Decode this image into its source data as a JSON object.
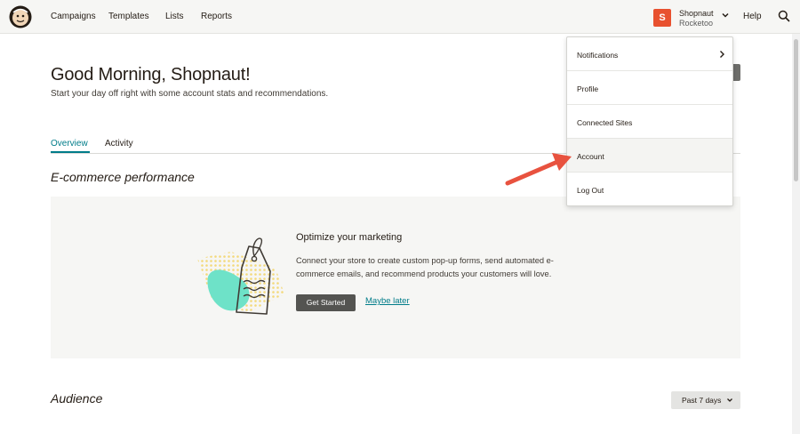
{
  "nav": {
    "links": [
      "Campaigns",
      "Templates",
      "Lists",
      "Reports"
    ],
    "account_initial": "S",
    "account_name": "Shopnaut",
    "account_org": "Rocketoo",
    "help": "Help"
  },
  "main": {
    "greeting": "Good Morning, Shopnaut!",
    "subtitle": "Start your day off right with some account stats and recommendations.",
    "tabs": [
      "Overview",
      "Activity"
    ],
    "ecommerce_title": "E-commerce performance",
    "card": {
      "title": "Optimize your marketing",
      "body": "Connect your store to create custom pop-up forms, send automated e-commerce emails, and recommend products your customers will love.",
      "primary_button": "Get Started",
      "secondary_link": "Maybe later"
    },
    "audience_title": "Audience",
    "range_select": "Past 7 days"
  },
  "dropdown": {
    "items": [
      "Notifications",
      "Profile",
      "Connected Sites",
      "Account",
      "Log Out"
    ],
    "highlighted": "Account"
  },
  "colors": {
    "accent": "#007c89",
    "brand_badge": "#e8512f",
    "annotation_arrow": "#e8523f",
    "art_mint": "#6ee2c8",
    "art_dots": "#f3d97a"
  },
  "icons": {
    "logo": "mailchimp-freddie-icon",
    "search": "search-icon",
    "account_chevron": "chevron-down-icon",
    "notifications_chevron": "chevron-right-icon",
    "range_chevron": "chevron-down-icon"
  }
}
